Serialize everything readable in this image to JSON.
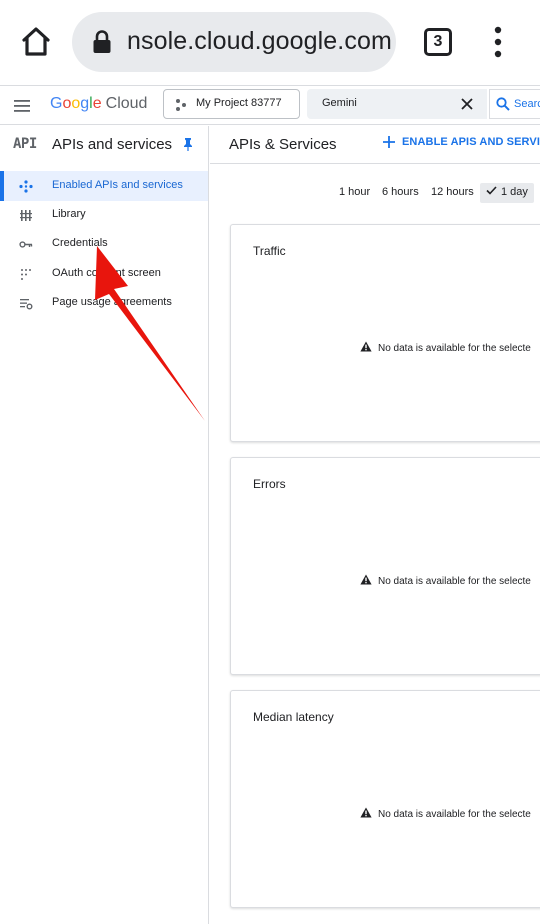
{
  "browser": {
    "url": "nsole.cloud.google.com",
    "tab_count": "3"
  },
  "header": {
    "logo_letters": [
      "G",
      "o",
      "o",
      "g",
      "l",
      "e"
    ],
    "logo_cloud": "Cloud",
    "project": "My Project 83777",
    "search_value": "Gemini",
    "search_button": "Searc"
  },
  "sidebar": {
    "badge": "API",
    "title": "APIs and services",
    "items": [
      {
        "label": "Enabled APIs and services",
        "icon": "diamond-dots-icon",
        "active": true
      },
      {
        "label": "Library",
        "icon": "library-icon",
        "active": false
      },
      {
        "label": "Credentials",
        "icon": "key-icon",
        "active": false
      },
      {
        "label": "OAuth consent screen",
        "icon": "consent-dots-icon",
        "active": false
      },
      {
        "label": "Page usage agreements",
        "icon": "settings-list-icon",
        "active": false
      }
    ]
  },
  "main": {
    "title": "APIs & Services",
    "enable_button": "ENABLE APIS AND SERVICES",
    "time_ranges": [
      "1 hour",
      "6 hours",
      "12 hours",
      "1 day"
    ],
    "selected_time_range": "1 day",
    "cards": [
      {
        "title": "Traffic",
        "message": "No data is available for the selecte"
      },
      {
        "title": "Errors",
        "message": "No data is available for the selecte"
      },
      {
        "title": "Median latency",
        "message": "No data is available for the selecte"
      }
    ]
  },
  "colors": {
    "accent": "#1a73e8",
    "active_bg": "#e8f0fe",
    "annotation": "#e8150d"
  }
}
